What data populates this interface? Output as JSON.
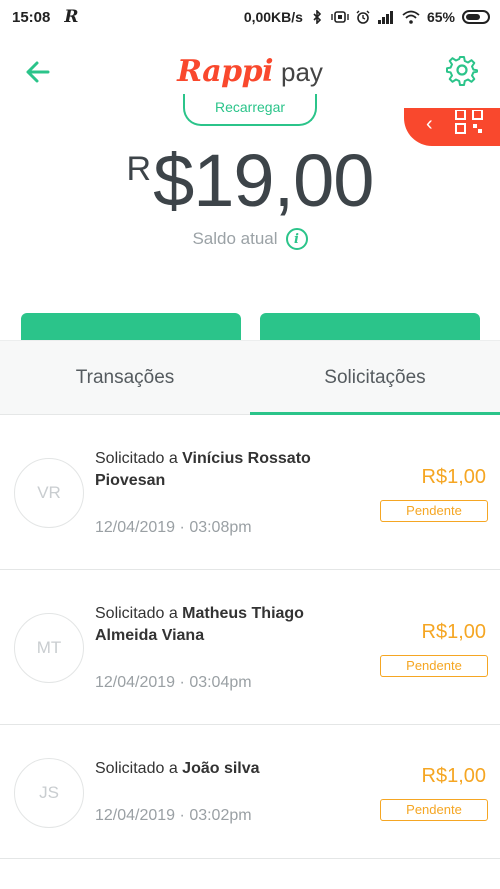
{
  "status_bar": {
    "time": "15:08",
    "app_glyph": "R",
    "network_speed": "0,00KB/s",
    "battery_percent": "65%",
    "icons": [
      "bluetooth-icon",
      "vibrate-icon",
      "alarm-icon",
      "signal-icon",
      "wifi-icon",
      "battery-icon"
    ]
  },
  "header": {
    "brand": "Rappi",
    "product": "pay",
    "back_icon": "arrow-left-icon",
    "settings_icon": "gear-icon"
  },
  "balance": {
    "top_button_label": "Recarregar",
    "currency": "R",
    "amount": "$19,00",
    "caption": "Saldo atual",
    "info_icon": "i",
    "qr_icon": "qr-code-icon"
  },
  "tabs": [
    {
      "label": "Transações",
      "active": false
    },
    {
      "label": "Solicitações",
      "active": true
    }
  ],
  "requests": [
    {
      "initials": "VR",
      "prefix": "Solicitado a ",
      "name": "Vinícius Rossato Piovesan",
      "date": "12/04/2019",
      "separator": "·",
      "time": "03:08pm",
      "amount": "R$1,00",
      "status": "Pendente"
    },
    {
      "initials": "MT",
      "prefix": "Solicitado a ",
      "name": "Matheus Thiago Almeida Viana",
      "date": "12/04/2019",
      "separator": "·",
      "time": "03:04pm",
      "amount": "R$1,00",
      "status": "Pendente"
    },
    {
      "initials": "JS",
      "prefix": "Solicitado a ",
      "name": "João silva",
      "date": "12/04/2019",
      "separator": "·",
      "time": "03:02pm",
      "amount": "R$1,00",
      "status": "Pendente"
    }
  ],
  "colors": {
    "brand_red": "#f9482d",
    "accent_green": "#2bc48a",
    "pending_orange": "#f5a623",
    "balance_text": "#3d4449"
  }
}
